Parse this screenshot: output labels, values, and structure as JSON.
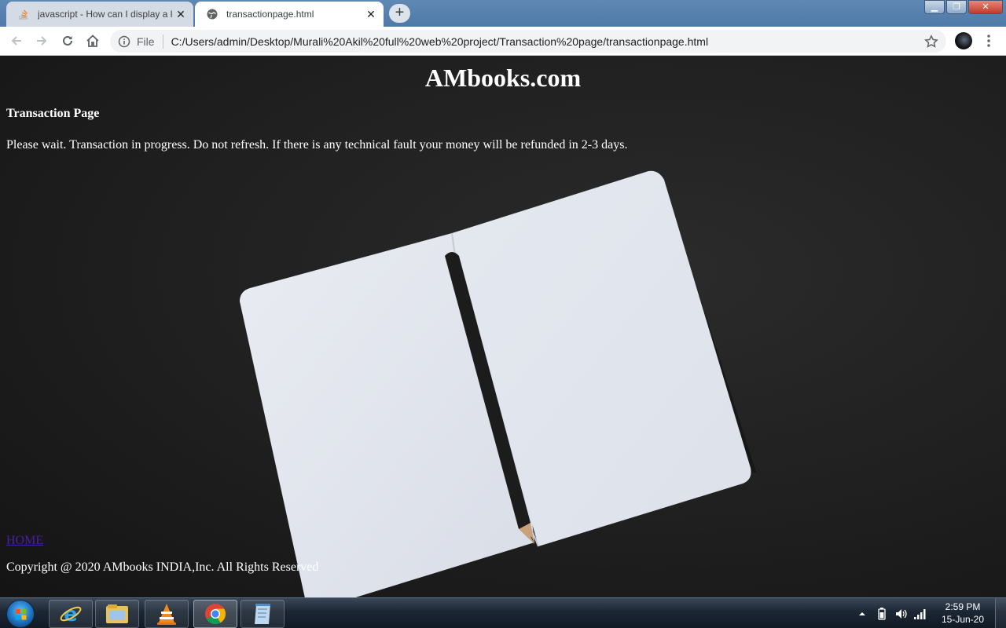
{
  "browser": {
    "tabs": [
      {
        "title": "javascript - How can I display a lo",
        "icon": "stackoverflow-icon",
        "active": false
      },
      {
        "title": "transactionpage.html",
        "icon": "globe-icon",
        "active": true
      }
    ],
    "address_bar": {
      "scheme_label": "File",
      "url": "C:/Users/admin/Desktop/Murali%20Akil%20full%20web%20project/Transaction%20page/transactionpage.html"
    }
  },
  "page": {
    "site_title": "AMbooks.com",
    "heading": "Transaction Page",
    "message": "Please wait. Transaction in progress. Do not refresh. If there is any technical fault your money will be refunded in 2-3 days.",
    "home_link": "HOME",
    "copyright": "Copyright @ 2020 AMbooks INDIA,Inc. All Rights Reserved"
  },
  "taskbar": {
    "apps": [
      {
        "name": "internet-explorer",
        "icon": "ie-icon"
      },
      {
        "name": "file-explorer",
        "icon": "folder-icon"
      },
      {
        "name": "vlc-player",
        "icon": "vlc-icon"
      },
      {
        "name": "google-chrome",
        "icon": "chrome-icon"
      },
      {
        "name": "notepad",
        "icon": "notepad-icon"
      }
    ],
    "clock": {
      "time": "2:59 PM",
      "date": "15-Jun-20"
    }
  },
  "colors": {
    "link_visited": "#4b1fa3",
    "page_text": "#ffffff",
    "page_background": "#1f1f1f"
  }
}
